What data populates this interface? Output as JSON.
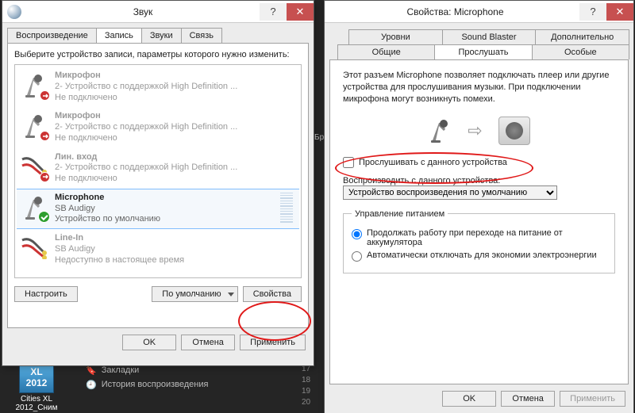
{
  "left": {
    "title": "Звук",
    "tabs": [
      "Воспроизведение",
      "Запись",
      "Звуки",
      "Связь"
    ],
    "active_tab_index": 1,
    "instruction": "Выберите устройство записи, параметры которого нужно изменить:",
    "devices": [
      {
        "name": "Микрофон",
        "sub": "2- Устройство с поддержкой High Definition ...",
        "status": "Не подключено",
        "icon": "mic",
        "grey": true,
        "badge": "x"
      },
      {
        "name": "Микрофон",
        "sub": "2- Устройство с поддержкой High Definition ...",
        "status": "Не подключено",
        "icon": "mic",
        "grey": true,
        "badge": "x"
      },
      {
        "name": "Лин. вход",
        "sub": "2- Устройство с поддержкой High Definition ...",
        "status": "Не подключено",
        "icon": "linein",
        "grey": true,
        "badge": "x"
      },
      {
        "name": "Microphone",
        "sub": "SB Audigy",
        "status": "Устройство по умолчанию",
        "icon": "mic",
        "grey": false,
        "badge": "check",
        "selected": true,
        "level": true
      },
      {
        "name": "Line-In",
        "sub": "SB Audigy",
        "status": "Недоступно в настоящее время",
        "icon": "linein",
        "grey": true,
        "badge": null
      }
    ],
    "configure_btn": "Настроить",
    "default_btn": "По умолчанию",
    "properties_btn": "Свойства",
    "ok": "OK",
    "cancel": "Отмена",
    "apply": "Применить"
  },
  "right": {
    "title": "Свойства: Microphone",
    "tabs_row1": [
      "Уровни",
      "Sound Blaster",
      "Дополнительно"
    ],
    "tabs_row2": [
      "Общие",
      "Прослушать",
      "Особые"
    ],
    "active_tab": "Прослушать",
    "description": "Этот разъем Microphone позволяет подключать плеер или другие устройства для прослушивания музыки. При подключении микрофона могут возникнуть помехи.",
    "listen_checkbox": "Прослушивать с данного устройства",
    "listen_checked": false,
    "playback_label": "Воспроизводить с данного устройства:",
    "playback_selected": "Устройство воспроизведения по умолчанию",
    "power_legend": "Управление питанием",
    "radio1": "Продолжать работу при переходе на питание от аккумулятора",
    "radio2": "Автоматически отключать для экономии электроэнергии",
    "radio_selected": 0,
    "ok": "OK",
    "cancel": "Отмена",
    "apply": "Применить"
  },
  "bg": {
    "desktop_label": "Cities XL 2012_Сним",
    "tile_text": "XL 2012",
    "menu_items": [
      "Закладки",
      "История воспроизведения"
    ],
    "numbers": [
      "17",
      "18",
      "19",
      "20"
    ],
    "bp_short": "Бр"
  }
}
